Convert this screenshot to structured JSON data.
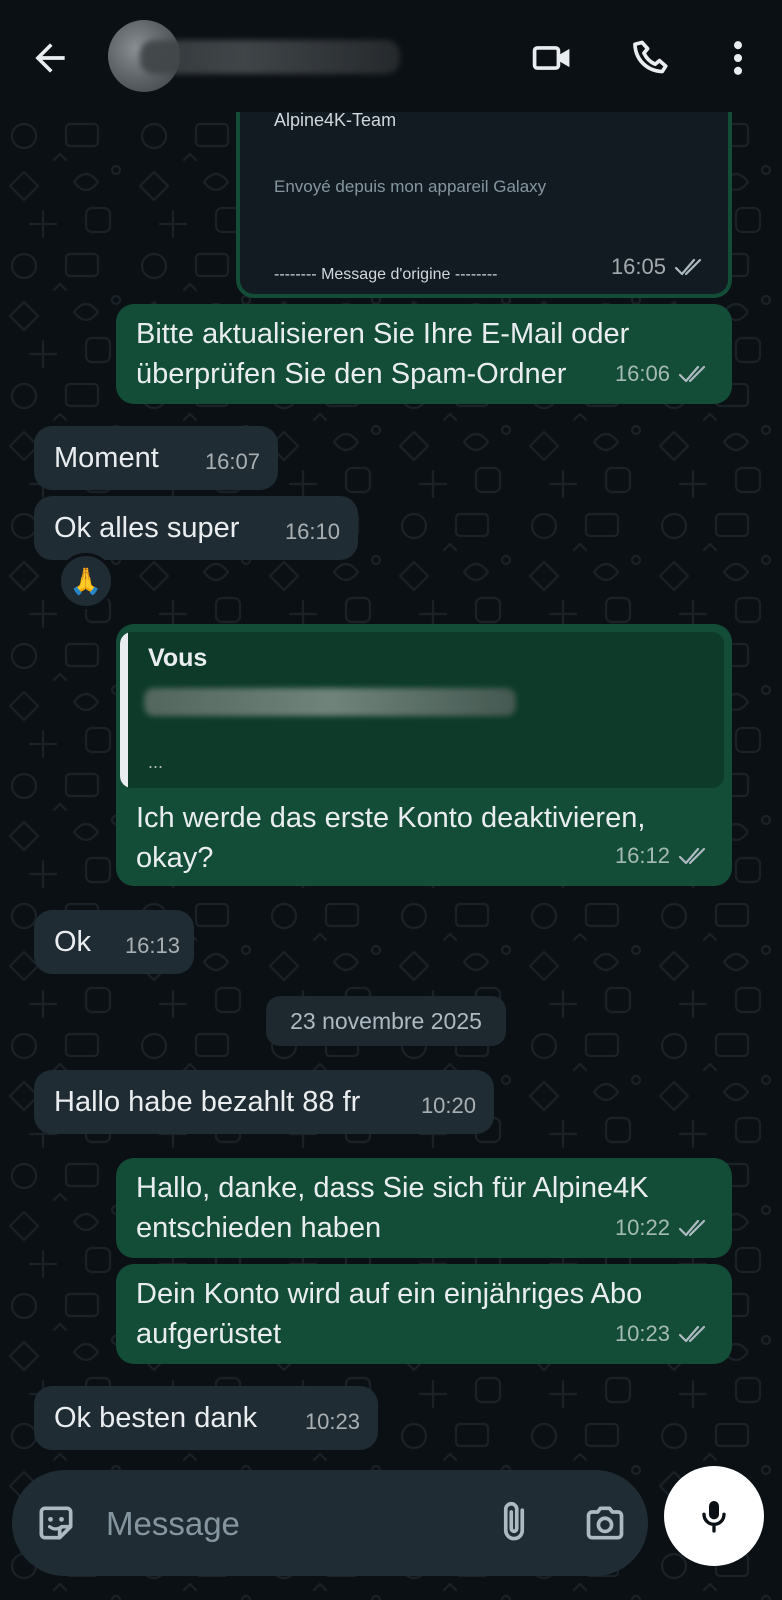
{
  "colors": {
    "background": "#0b1014",
    "outgoing_bubble": "#134d37",
    "incoming_bubble": "#202c33",
    "timestamp": "#8696a0"
  },
  "header": {
    "back_icon": "arrow-left-icon",
    "video_icon": "video-camera-icon",
    "call_icon": "phone-icon",
    "more_icon": "more-vertical-icon"
  },
  "forwarded_card": {
    "name": "Alpine4K-Team",
    "signature": "Envoyé depuis mon appareil Galaxy",
    "original_marker": "-------- Message d'origine --------",
    "time": "16:05"
  },
  "messages": [
    {
      "direction": "out",
      "text": "Bitte aktualisieren Sie Ihre E-Mail oder\nüberprüfen Sie den Spam-Ordner",
      "time": "16:06"
    },
    {
      "direction": "in",
      "text": "Moment",
      "time": "16:07"
    },
    {
      "direction": "in",
      "text": "Ok alles super",
      "time": "16:10",
      "reaction": "🙏"
    },
    {
      "direction": "out",
      "quote_author": "Vous",
      "quote_ellipsis": "...",
      "text": "Ich werde das erste Konto deaktivieren,\nokay?",
      "time": "16:12"
    },
    {
      "direction": "in",
      "text": "Ok",
      "time": "16:13"
    },
    {
      "direction": "in",
      "text": "Hallo habe bezahlt 88 fr",
      "time": "10:20"
    },
    {
      "direction": "out",
      "text": "Hallo, danke, dass Sie sich für Alpine4K\nentschieden haben",
      "time": "10:22"
    },
    {
      "direction": "out",
      "text": "Dein Konto wird auf ein einjähriges Abo\naufgerüstet",
      "time": "10:23"
    },
    {
      "direction": "in",
      "text": "Ok besten dank",
      "time": "10:23"
    }
  ],
  "date_separator": "23 novembre 2025",
  "composer": {
    "placeholder": "Message",
    "emoji_icon": "sticker-icon",
    "attach_icon": "paperclip-icon",
    "camera_icon": "camera-icon",
    "mic_icon": "microphone-icon"
  }
}
